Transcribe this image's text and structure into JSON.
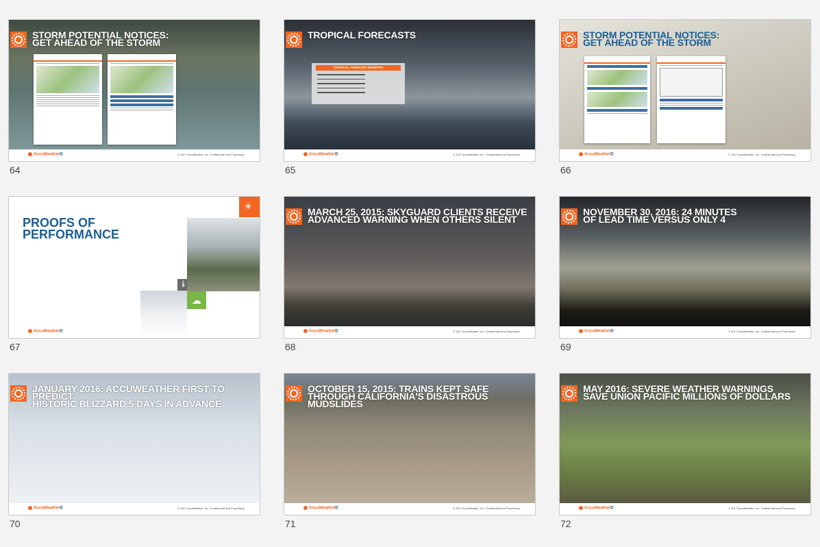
{
  "slides": [
    {
      "number": "64",
      "title_lines": [
        "STORM POTENTIAL NOTICES:",
        "GET AHEAD OF THE STORM"
      ]
    },
    {
      "number": "65",
      "title_lines": [
        "TROPICAL FORECASTS"
      ],
      "box_header": "TROPICAL FORECAST BENEFITS"
    },
    {
      "number": "66",
      "title_lines": [
        "STORM POTENTIAL NOTICES:",
        "GET AHEAD OF THE STORM"
      ]
    },
    {
      "number": "67",
      "title_lines": [
        "PROOFS OF",
        "PERFORMANCE"
      ]
    },
    {
      "number": "68",
      "title_lines": [
        "MARCH 25, 2015: SKYGUARD CLIENTS RECEIVE",
        "ADVANCED WARNING WHEN OTHERS SILENT"
      ]
    },
    {
      "number": "69",
      "title_lines": [
        "NOVEMBER 30, 2016: 24 MINUTES",
        "OF LEAD TIME VERSUS ONLY 4"
      ]
    },
    {
      "number": "70",
      "title_lines": [
        "JANUARY 2016: ACCUWEATHER FIRST TO PREDICT",
        "HISTORIC BLIZZARD 5 DAYS IN ADVANCE"
      ]
    },
    {
      "number": "71",
      "title_lines": [
        "OCTOBER 15, 2015: TRAINS KEPT SAFE",
        "THROUGH CALIFORNIA'S DISASTROUS MUDSLIDES"
      ]
    },
    {
      "number": "72",
      "title_lines": [
        "MAY 2016: SEVERE WEATHER WARNINGS",
        "SAVE UNION PACIFIC MILLIONS OF DOLLARS"
      ]
    }
  ],
  "footer": {
    "logo": "AccuWeather",
    "logo_mark": "D",
    "copyright": "© 2017 AccuWeather, Inc. Confidential and Proprietary"
  }
}
